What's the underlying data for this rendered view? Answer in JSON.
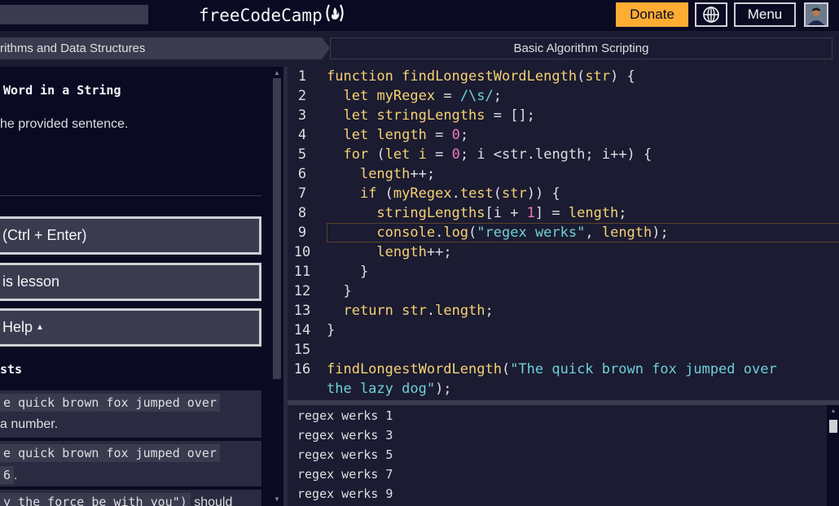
{
  "nav": {
    "logo_text": "freeCodeCamp",
    "donate_label": "Donate",
    "menu_label": "Menu"
  },
  "breadcrumb": {
    "left": "rithms and Data Structures",
    "right": "Basic Algorithm Scripting"
  },
  "instructions": {
    "title": "Word in a String",
    "description": "he provided sentence.",
    "run_button": "(Ctrl + Enter)",
    "reset_button": "is lesson",
    "help_button": "Help",
    "tests_heading": "sts",
    "tests": [
      {
        "code": "e quick brown fox jumped over",
        "text": "a number.",
        "code2": ""
      },
      {
        "code": "e quick brown fox jumped over",
        "text": ".",
        "code2": "6"
      },
      {
        "code": "y the force be with you\")",
        "text": " should",
        "code2": ""
      }
    ]
  },
  "editor": {
    "active_line": 9,
    "lines": [
      {
        "n": "1",
        "tokens": [
          [
            "k",
            "function "
          ],
          [
            "fn",
            "findLongestWordLength"
          ],
          [
            "plain",
            "("
          ],
          [
            "fn",
            "str"
          ],
          [
            "plain",
            ") {"
          ]
        ]
      },
      {
        "n": "2",
        "tokens": [
          [
            "plain",
            "  "
          ],
          [
            "k",
            "let "
          ],
          [
            "fn",
            "myRegex"
          ],
          [
            "plain",
            " = "
          ],
          [
            "reg",
            "/\\s/"
          ],
          [
            "plain",
            ";"
          ]
        ]
      },
      {
        "n": "3",
        "tokens": [
          [
            "plain",
            "  "
          ],
          [
            "k",
            "let "
          ],
          [
            "fn",
            "stringLengths"
          ],
          [
            "plain",
            " = [];"
          ]
        ]
      },
      {
        "n": "4",
        "tokens": [
          [
            "plain",
            "  "
          ],
          [
            "k",
            "let "
          ],
          [
            "fn",
            "length"
          ],
          [
            "plain",
            " = "
          ],
          [
            "num",
            "0"
          ],
          [
            "plain",
            ";"
          ]
        ]
      },
      {
        "n": "5",
        "tokens": [
          [
            "plain",
            "  "
          ],
          [
            "k",
            "for "
          ],
          [
            "plain",
            "("
          ],
          [
            "k",
            "let "
          ],
          [
            "fn",
            "i"
          ],
          [
            "plain",
            " = "
          ],
          [
            "num",
            "0"
          ],
          [
            "plain",
            "; i <str.length; i++) {"
          ]
        ]
      },
      {
        "n": "6",
        "tokens": [
          [
            "plain",
            "    "
          ],
          [
            "fn",
            "length"
          ],
          [
            "plain",
            "++;"
          ]
        ]
      },
      {
        "n": "7",
        "tokens": [
          [
            "plain",
            "    "
          ],
          [
            "k",
            "if "
          ],
          [
            "plain",
            "("
          ],
          [
            "fn",
            "myRegex"
          ],
          [
            "plain",
            "."
          ],
          [
            "fn",
            "test"
          ],
          [
            "plain",
            "("
          ],
          [
            "fn",
            "str"
          ],
          [
            "plain",
            ")) {"
          ]
        ]
      },
      {
        "n": "8",
        "tokens": [
          [
            "plain",
            "      "
          ],
          [
            "fn",
            "stringLengths"
          ],
          [
            "plain",
            "[i + "
          ],
          [
            "num",
            "1"
          ],
          [
            "plain",
            "] = "
          ],
          [
            "fn",
            "length"
          ],
          [
            "plain",
            ";"
          ]
        ]
      },
      {
        "n": "9",
        "tokens": [
          [
            "plain",
            "      "
          ],
          [
            "fn",
            "console"
          ],
          [
            "plain",
            "."
          ],
          [
            "fn",
            "log"
          ],
          [
            "plain",
            "("
          ],
          [
            "str",
            "\"regex werks\""
          ],
          [
            "plain",
            ", "
          ],
          [
            "fn",
            "length"
          ],
          [
            "plain",
            ");"
          ]
        ]
      },
      {
        "n": "10",
        "tokens": [
          [
            "plain",
            "      "
          ],
          [
            "fn",
            "length"
          ],
          [
            "plain",
            "++;"
          ]
        ]
      },
      {
        "n": "11",
        "tokens": [
          [
            "plain",
            "    }"
          ]
        ]
      },
      {
        "n": "12",
        "tokens": [
          [
            "plain",
            "  }"
          ]
        ]
      },
      {
        "n": "13",
        "tokens": [
          [
            "plain",
            "  "
          ],
          [
            "k",
            "return "
          ],
          [
            "fn",
            "str"
          ],
          [
            "plain",
            "."
          ],
          [
            "fn",
            "length"
          ],
          [
            "plain",
            ";"
          ]
        ]
      },
      {
        "n": "14",
        "tokens": [
          [
            "plain",
            "}"
          ]
        ]
      },
      {
        "n": "15",
        "tokens": []
      },
      {
        "n": "16",
        "tokens": [
          [
            "fn",
            "findLongestWordLength"
          ],
          [
            "plain",
            "("
          ],
          [
            "str",
            "\"The quick brown fox jumped over"
          ]
        ]
      },
      {
        "n": "",
        "tokens": [
          [
            "str",
            "the lazy dog\""
          ],
          [
            "plain",
            ");"
          ]
        ]
      }
    ]
  },
  "console": {
    "lines": [
      "regex werks 1",
      "regex werks 3",
      "regex werks 5",
      "regex werks 7",
      "regex werks 9"
    ]
  },
  "colors": {
    "nav_bg": "#0a0a23",
    "panel_bg": "#0a0a23",
    "editor_bg": "#1b1b32",
    "keyword": "#f6d271",
    "string": "#6ed1d6",
    "number": "#f178b6",
    "donate": "#feac32"
  }
}
